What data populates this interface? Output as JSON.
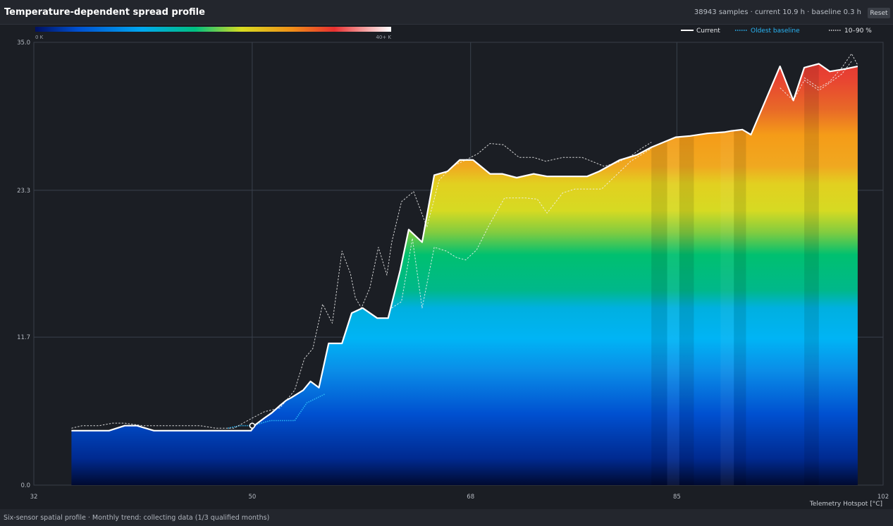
{
  "header": {
    "title": "Temperature-dependent spread profile",
    "stats": "38943 samples · current 10.9 h · baseline 0.3 h",
    "reset_label": "Reset"
  },
  "footer": {
    "status": "Six-sensor spatial profile · Monthly trend: collecting data (1/3 qualified months)"
  },
  "colorbar": {
    "min_label": "0 K",
    "max_label": "40+ K",
    "stops": [
      "#001060",
      "#0050d0",
      "#00a8f0",
      "#00c080",
      "#d8dc20",
      "#f09018",
      "#e83030",
      "#ffffff"
    ]
  },
  "legend": {
    "current": "Current",
    "baseline": "Oldest baseline",
    "band": "10–90 %",
    "baseline_color": "#29b6f6"
  },
  "chart_data": {
    "type": "area",
    "title": "Temperature-dependent spread profile",
    "xlabel": "Telemetry Hotspot [°C]",
    "ylabel": "",
    "xlim": [
      32,
      102
    ],
    "ylim": [
      0,
      35
    ],
    "xticks": [
      "32",
      "50",
      "68",
      "85",
      "102"
    ],
    "yticks": [
      "0.0",
      "11.7",
      "23.3",
      "35.0"
    ],
    "grid": true,
    "legend_position": "top-right",
    "series": [
      {
        "name": "Current",
        "style": "solid",
        "x": [
          35.1,
          37.4,
          38.2,
          39.5,
          40.5,
          41.9,
          43.1,
          44.9,
          46.3,
          48.3,
          49.9,
          50.3,
          51.0,
          51.6,
          52.3,
          52.8,
          53.2,
          54.2,
          54.8,
          55.5,
          56.3,
          57.4,
          58.2,
          59.1,
          60.3,
          61.2,
          62.2,
          62.9,
          64.0,
          65.0,
          66.1,
          67.1,
          68.2,
          69.6,
          70.6,
          71.8,
          73.2,
          74.3,
          75.2,
          76.4,
          77.6,
          78.6,
          80.3,
          81.7,
          82.9,
          84.9,
          86.1,
          87.5,
          88.9,
          89.5,
          90.4,
          91.1,
          93.5,
          94.6,
          95.5,
          96.7,
          97.6,
          98.9,
          99.9
        ],
        "y": [
          4.3,
          4.3,
          4.3,
          4.7,
          4.7,
          4.3,
          4.3,
          4.3,
          4.3,
          4.3,
          4.3,
          4.8,
          5.3,
          5.7,
          6.3,
          6.7,
          6.9,
          7.5,
          8.2,
          7.7,
          11.2,
          11.2,
          13.6,
          14.0,
          13.2,
          13.2,
          17.0,
          20.2,
          19.2,
          24.5,
          24.8,
          25.7,
          25.7,
          24.6,
          24.6,
          24.3,
          24.6,
          24.4,
          24.4,
          24.4,
          24.4,
          24.8,
          25.7,
          26.1,
          26.7,
          27.5,
          27.6,
          27.8,
          27.9,
          28.0,
          28.1,
          27.7,
          33.1,
          30.4,
          33.0,
          33.3,
          32.7,
          32.9,
          33.1
        ]
      },
      {
        "name": "Oldest baseline",
        "style": "dotted",
        "x": [
          48.0,
          49.0,
          50.0,
          51.5,
          53.5,
          54.5,
          56.0
        ],
        "y": [
          4.5,
          4.7,
          4.7,
          5.1,
          5.1,
          6.5,
          7.2
        ]
      },
      {
        "name": "10–90 %",
        "style": "dashed",
        "x": [
          35.1,
          36.0,
          37.4,
          38.5,
          39.5,
          41.0,
          42.3,
          44.0,
          45.7,
          47.0,
          48.5,
          50.0,
          51.0,
          52.3,
          53.5,
          54.3,
          55.0,
          55.8,
          56.6,
          57.4,
          58.1,
          58.5,
          59.0,
          59.7,
          60.4,
          61.1,
          61.5,
          62.3,
          63.3,
          64.4,
          65.4,
          66.5,
          67.6,
          68.6,
          69.6,
          70.7,
          72.0,
          73.2,
          74.2,
          75.6,
          76.6,
          77.2,
          79.0,
          80.1,
          81.2,
          81.9,
          82.9
        ],
        "y": [
          4.5,
          4.7,
          4.7,
          4.9,
          4.9,
          4.7,
          4.7,
          4.7,
          4.7,
          4.5,
          4.5,
          5.3,
          5.8,
          6.1,
          7.5,
          10.0,
          10.8,
          14.3,
          12.8,
          18.5,
          16.7,
          14.8,
          14.0,
          15.6,
          18.8,
          16.6,
          19.2,
          22.4,
          23.2,
          20.4,
          24.1,
          25.2,
          25.7,
          26.2,
          27.0,
          26.9,
          25.9,
          25.9,
          25.6,
          25.9,
          25.9,
          25.9,
          25.2,
          25.5,
          26.0,
          26.5,
          27.1
        ]
      },
      {
        "name": "10–90 %",
        "style": "dashed",
        "x": [
          61.5,
          62.3,
          63.2,
          64.0,
          65.0,
          66.0,
          66.8,
          67.6,
          68.5,
          69.5,
          70.8,
          72.5,
          73.5,
          74.3,
          75.6,
          76.6,
          77.6,
          78.8,
          80.0,
          81.2,
          82.9
        ],
        "y": [
          14.0,
          14.5,
          19.5,
          14.0,
          18.8,
          18.5,
          18.0,
          17.8,
          18.6,
          20.5,
          22.7,
          22.7,
          22.6,
          21.5,
          23.1,
          23.4,
          23.4,
          23.4,
          24.5,
          25.6,
          26.6
        ]
      },
      {
        "name": "10–90 %",
        "style": "dashed",
        "x": [
          95.5,
          96.7,
          97.6,
          98.6,
          99.4,
          99.9
        ],
        "y": [
          32.2,
          31.4,
          31.9,
          33.0,
          34.1,
          33.2
        ]
      },
      {
        "name": "10–90 %",
        "style": "dashed",
        "x": [
          93.5,
          94.6,
          95.5,
          96.7,
          97.6,
          98.6,
          99.4
        ],
        "y": [
          31.4,
          30.4,
          32.0,
          31.2,
          31.8,
          32.5,
          33.5
        ]
      }
    ],
    "marker": {
      "x": 50.0,
      "y": 4.7
    },
    "bands": [
      {
        "x0": 82.9,
        "x1": 84.2,
        "shade": "dark"
      },
      {
        "x0": 84.2,
        "x1": 85.2,
        "shade": "light"
      },
      {
        "x0": 85.2,
        "x1": 86.4,
        "shade": "dark"
      },
      {
        "x0": 88.6,
        "x1": 89.7,
        "shade": "light"
      },
      {
        "x0": 89.7,
        "x1": 90.7,
        "shade": "dark"
      },
      {
        "x0": 95.5,
        "x1": 96.7,
        "shade": "dark"
      }
    ]
  }
}
